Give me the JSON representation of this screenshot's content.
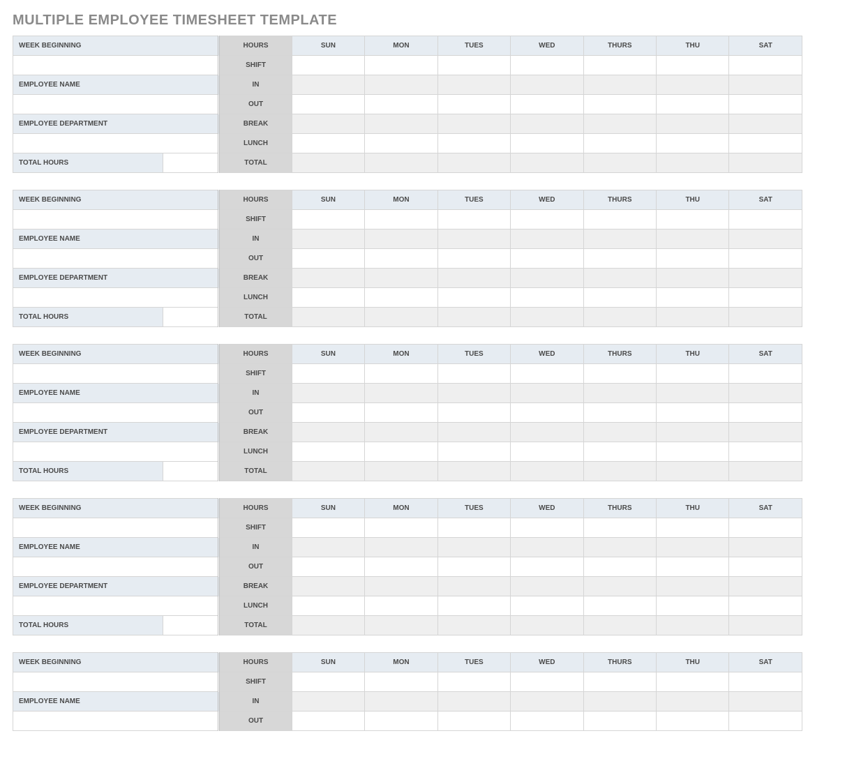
{
  "title": "MULTIPLE EMPLOYEE TIMESHEET TEMPLATE",
  "labels": {
    "week_beginning": "WEEK BEGINNING",
    "employee_name": "EMPLOYEE NAME",
    "employee_department": "EMPLOYEE DEPARTMENT",
    "total_hours": "TOTAL HOURS",
    "hours": "HOURS",
    "shift": "SHIFT",
    "in": "IN",
    "out": "OUT",
    "break": "BREAK",
    "lunch": "LUNCH",
    "total": "TOTAL"
  },
  "days": [
    "SUN",
    "MON",
    "TUES",
    "WED",
    "THURS",
    "THU",
    "SAT"
  ],
  "blocks": [
    {
      "week_beginning": "",
      "employee_name": "",
      "employee_department": "",
      "total_hours": "",
      "shift": [
        "",
        "",
        "",
        "",
        "",
        "",
        ""
      ],
      "in": [
        "",
        "",
        "",
        "",
        "",
        "",
        ""
      ],
      "out": [
        "",
        "",
        "",
        "",
        "",
        "",
        ""
      ],
      "break": [
        "",
        "",
        "",
        "",
        "",
        "",
        ""
      ],
      "lunch": [
        "",
        "",
        "",
        "",
        "",
        "",
        ""
      ],
      "total": [
        "",
        "",
        "",
        "",
        "",
        "",
        ""
      ]
    },
    {
      "week_beginning": "",
      "employee_name": "",
      "employee_department": "",
      "total_hours": "",
      "shift": [
        "",
        "",
        "",
        "",
        "",
        "",
        ""
      ],
      "in": [
        "",
        "",
        "",
        "",
        "",
        "",
        ""
      ],
      "out": [
        "",
        "",
        "",
        "",
        "",
        "",
        ""
      ],
      "break": [
        "",
        "",
        "",
        "",
        "",
        "",
        ""
      ],
      "lunch": [
        "",
        "",
        "",
        "",
        "",
        "",
        ""
      ],
      "total": [
        "",
        "",
        "",
        "",
        "",
        "",
        ""
      ]
    },
    {
      "week_beginning": "",
      "employee_name": "",
      "employee_department": "",
      "total_hours": "",
      "shift": [
        "",
        "",
        "",
        "",
        "",
        "",
        ""
      ],
      "in": [
        "",
        "",
        "",
        "",
        "",
        "",
        ""
      ],
      "out": [
        "",
        "",
        "",
        "",
        "",
        "",
        ""
      ],
      "break": [
        "",
        "",
        "",
        "",
        "",
        "",
        ""
      ],
      "lunch": [
        "",
        "",
        "",
        "",
        "",
        "",
        ""
      ],
      "total": [
        "",
        "",
        "",
        "",
        "",
        "",
        ""
      ]
    },
    {
      "week_beginning": "",
      "employee_name": "",
      "employee_department": "",
      "total_hours": "",
      "shift": [
        "",
        "",
        "",
        "",
        "",
        "",
        ""
      ],
      "in": [
        "",
        "",
        "",
        "",
        "",
        "",
        ""
      ],
      "out": [
        "",
        "",
        "",
        "",
        "",
        "",
        ""
      ],
      "break": [
        "",
        "",
        "",
        "",
        "",
        "",
        ""
      ],
      "lunch": [
        "",
        "",
        "",
        "",
        "",
        "",
        ""
      ],
      "total": [
        "",
        "",
        "",
        "",
        "",
        "",
        ""
      ]
    },
    {
      "week_beginning": "",
      "employee_name": "",
      "employee_department": "",
      "total_hours": "",
      "shift": [
        "",
        "",
        "",
        "",
        "",
        "",
        ""
      ],
      "in": [
        "",
        "",
        "",
        "",
        "",
        "",
        ""
      ],
      "out": [
        "",
        "",
        "",
        "",
        "",
        "",
        ""
      ],
      "break": [
        "",
        "",
        "",
        "",
        "",
        "",
        ""
      ],
      "lunch": [
        "",
        "",
        "",
        "",
        "",
        "",
        ""
      ],
      "total": [
        "",
        "",
        "",
        "",
        "",
        "",
        ""
      ]
    }
  ],
  "visible_blocks_full": 4,
  "fifth_block_visible_rows": 4
}
